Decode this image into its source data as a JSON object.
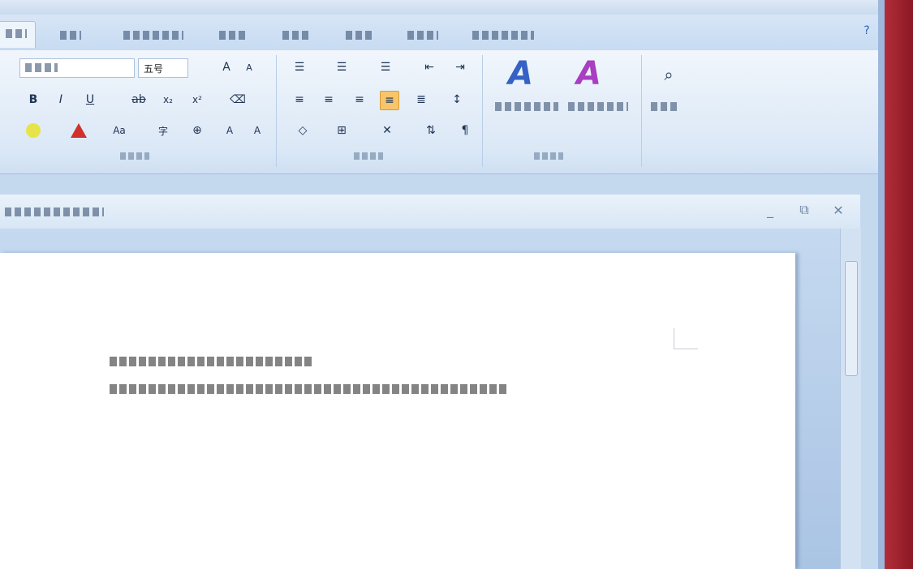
{
  "home": {
    "font_size": "五号"
  },
  "colors": {
    "ribbon_bg": "#dbe8f6",
    "active_button": "#f8c56b",
    "desktop_accent": "#b12d39"
  },
  "icons": {
    "style_change": "stylized-A-icon",
    "style_select": "stylized-AA-icon",
    "editing": "binoculars-icon"
  }
}
